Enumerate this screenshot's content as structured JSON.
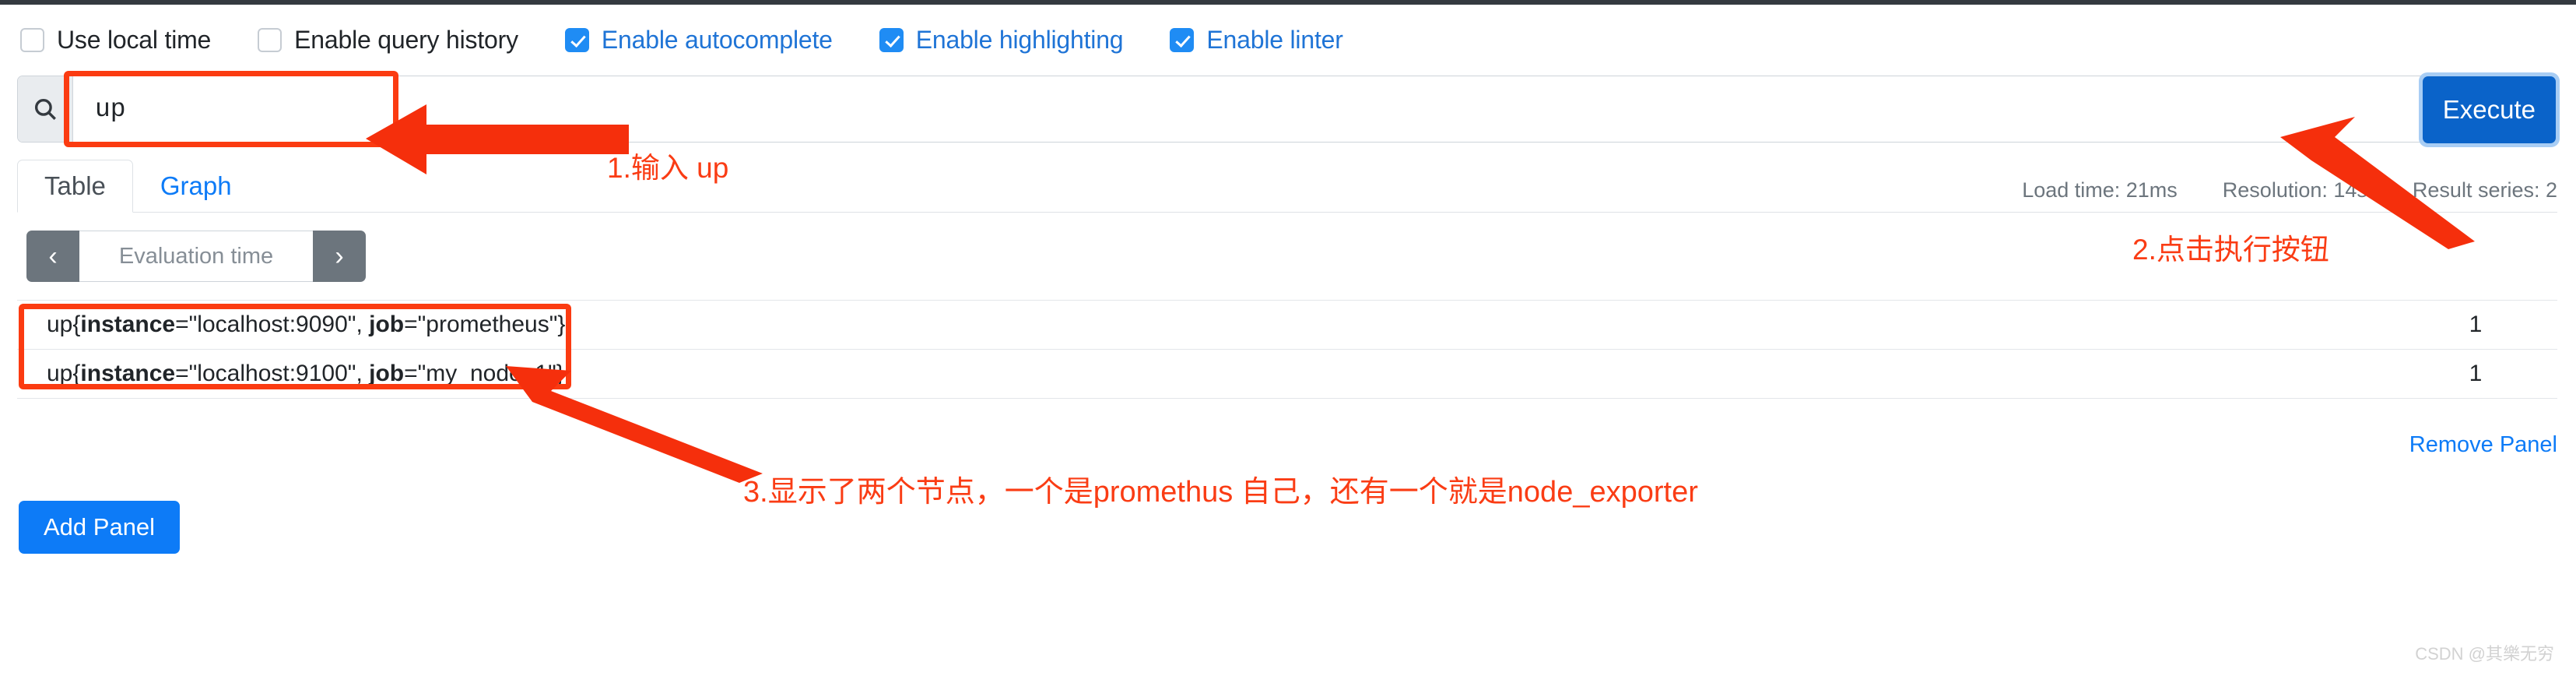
{
  "options": [
    {
      "label": "Use local time",
      "checked": false
    },
    {
      "label": "Enable query history",
      "checked": false
    },
    {
      "label": "Enable autocomplete",
      "checked": true
    },
    {
      "label": "Enable highlighting",
      "checked": true
    },
    {
      "label": "Enable linter",
      "checked": true
    }
  ],
  "query": {
    "value": "up",
    "search_icon": "search-icon",
    "format_icon": "indent-icon",
    "globe_icon": "globe-icon",
    "execute_label": "Execute"
  },
  "tabs": [
    {
      "label": "Table",
      "active": true
    },
    {
      "label": "Graph",
      "active": false
    }
  ],
  "status": {
    "load_time": "Load time: 21ms",
    "resolution": "Resolution: 14s",
    "result_series": "Result series: 2"
  },
  "evaluation": {
    "prev_icon": "chevron-left-icon",
    "next_icon": "chevron-right-icon",
    "placeholder": "Evaluation time"
  },
  "results": [
    {
      "metric": "up",
      "labels": [
        {
          "key": "instance",
          "value": "\"localhost:9090\""
        },
        {
          "key": "job",
          "value": "\"prometheus\""
        }
      ],
      "value": "1"
    },
    {
      "metric": "up",
      "labels": [
        {
          "key": "instance",
          "value": "\"localhost:9100\""
        },
        {
          "key": "job",
          "value": "\"my_node_1\""
        }
      ],
      "value": "1"
    }
  ],
  "footer": {
    "remove_panel": "Remove Panel",
    "add_panel": "Add Panel",
    "watermark": "CSDN @其樂无穷"
  },
  "annotations": [
    {
      "id": "a1",
      "text": "1.输入 up"
    },
    {
      "id": "a2",
      "text": "2.点击执行按钮"
    },
    {
      "id": "a3",
      "text": "3.显示了两个节点，一个是promethus 自己，还有一个就是node_exporter"
    }
  ],
  "colors": {
    "accent": "#0d7bf7",
    "execute": "#0a63c9",
    "annotation": "#fa3c14",
    "muted": "#6c757d"
  }
}
